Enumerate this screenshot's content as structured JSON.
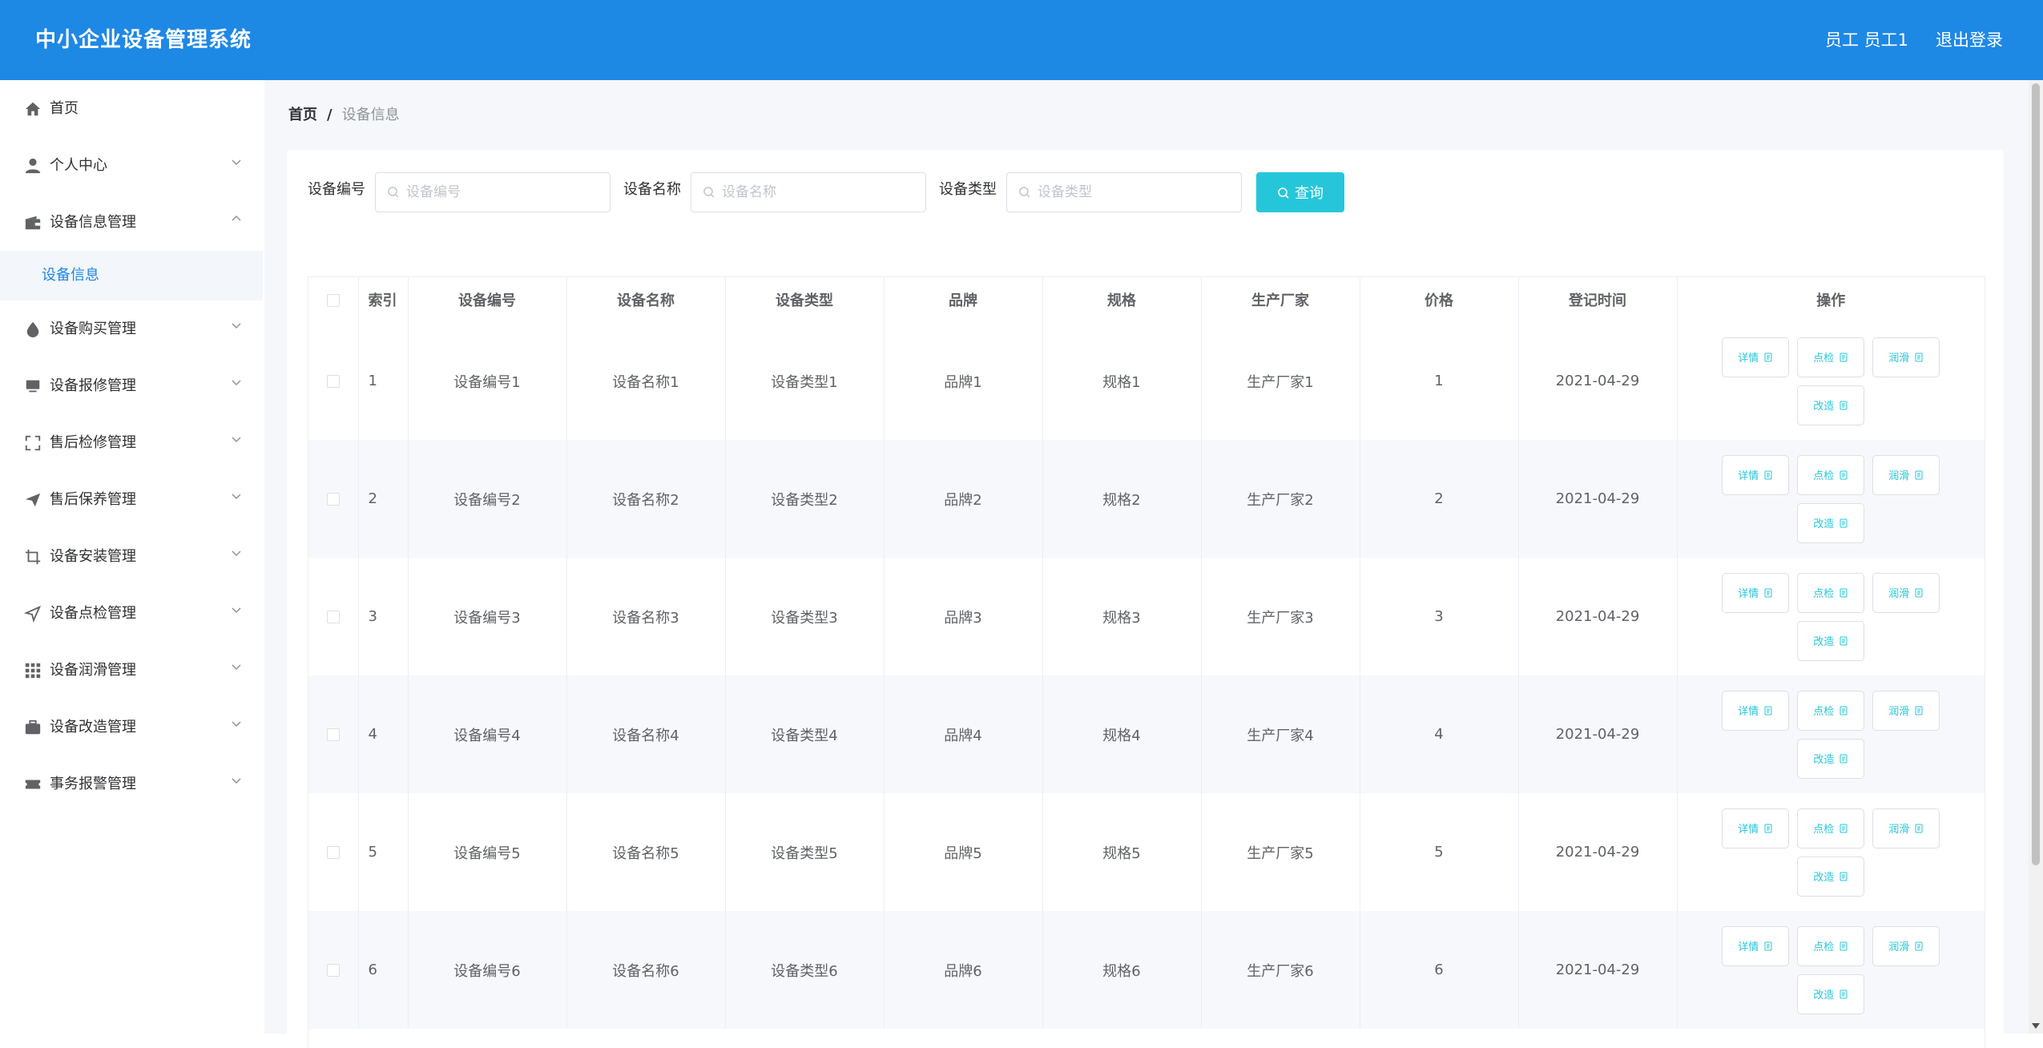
{
  "header": {
    "title": "中小企业设备管理系统",
    "user": "员工 员工1",
    "logout": "退出登录"
  },
  "sidebar": {
    "items": [
      {
        "label": "首页",
        "icon": "home-icon",
        "expandable": false
      },
      {
        "label": "个人中心",
        "icon": "user-icon",
        "expandable": true
      },
      {
        "label": "设备信息管理",
        "icon": "wallet-icon",
        "expandable": true,
        "expanded": true,
        "children": [
          {
            "label": "设备信息",
            "active": true
          }
        ]
      },
      {
        "label": "设备购买管理",
        "icon": "drop-icon",
        "expandable": true
      },
      {
        "label": "设备报修管理",
        "icon": "monitor-icon",
        "expandable": true
      },
      {
        "label": "售后检修管理",
        "icon": "fullscreen-icon",
        "expandable": true
      },
      {
        "label": "售后保养管理",
        "icon": "send-icon",
        "expandable": true
      },
      {
        "label": "设备安装管理",
        "icon": "crop-icon",
        "expandable": true
      },
      {
        "label": "设备点检管理",
        "icon": "location-arrow-icon",
        "expandable": true
      },
      {
        "label": "设备润滑管理",
        "icon": "grid-icon",
        "expandable": true
      },
      {
        "label": "设备改造管理",
        "icon": "briefcase-icon",
        "expandable": true
      },
      {
        "label": "事务报警管理",
        "icon": "ticket-icon",
        "expandable": true
      }
    ]
  },
  "breadcrumb": {
    "home": "首页",
    "separator": "/",
    "current": "设备信息"
  },
  "search": {
    "fields": [
      {
        "label": "设备编号",
        "placeholder": "设备编号",
        "value": ""
      },
      {
        "label": "设备名称",
        "placeholder": "设备名称",
        "value": ""
      },
      {
        "label": "设备类型",
        "placeholder": "设备类型",
        "value": ""
      }
    ],
    "button": "查询"
  },
  "table": {
    "headers": [
      "索引",
      "设备编号",
      "设备名称",
      "设备类型",
      "品牌",
      "规格",
      "生产厂家",
      "价格",
      "登记时间",
      "操作"
    ],
    "rows": [
      [
        "1",
        "设备编号1",
        "设备名称1",
        "设备类型1",
        "品牌1",
        "规格1",
        "生产厂家1",
        "1",
        "2021-04-29"
      ],
      [
        "2",
        "设备编号2",
        "设备名称2",
        "设备类型2",
        "品牌2",
        "规格2",
        "生产厂家2",
        "2",
        "2021-04-29"
      ],
      [
        "3",
        "设备编号3",
        "设备名称3",
        "设备类型3",
        "品牌3",
        "规格3",
        "生产厂家3",
        "3",
        "2021-04-29"
      ],
      [
        "4",
        "设备编号4",
        "设备名称4",
        "设备类型4",
        "品牌4",
        "规格4",
        "生产厂家4",
        "4",
        "2021-04-29"
      ],
      [
        "5",
        "设备编号5",
        "设备名称5",
        "设备类型5",
        "品牌5",
        "规格5",
        "生产厂家5",
        "5",
        "2021-04-29"
      ],
      [
        "6",
        "设备编号6",
        "设备名称6",
        "设备类型6",
        "品牌6",
        "规格6",
        "生产厂家6",
        "6",
        "2021-04-29"
      ]
    ],
    "actions": [
      "详情",
      "点检",
      "润滑",
      "改造"
    ]
  },
  "colors": {
    "header": "#1e88e5",
    "accent": "#26c6da",
    "active_menu": "#1e88e5"
  }
}
